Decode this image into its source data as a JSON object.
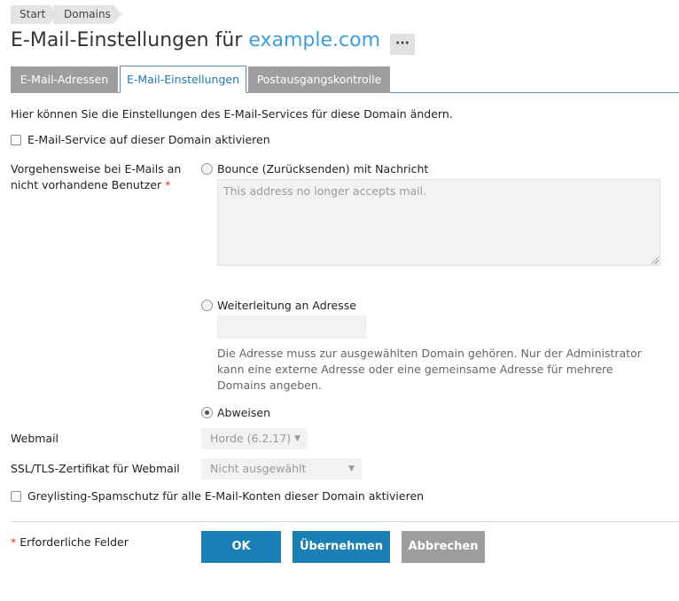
{
  "breadcrumb": [
    "Start",
    "Domains"
  ],
  "header": {
    "title_prefix": "E-Mail-Einstellungen für",
    "title_domain": "example.com",
    "more_label": "···"
  },
  "tabs": [
    {
      "label": "E-Mail-Adressen",
      "active": false
    },
    {
      "label": "E-Mail-Einstellungen",
      "active": true
    },
    {
      "label": "Postausgangskontrolle",
      "active": false
    }
  ],
  "intro": "Hier können Sie die Einstellungen des E-Mail-Services für diese Domain ändern.",
  "enable_mail_service": {
    "label": "E-Mail-Service auf dieser Domain aktivieren",
    "checked": false
  },
  "nonexistent_users": {
    "label_line1": "Vorgehensweise bei E-Mails an",
    "label_line2": "nicht vorhandene Benutzer",
    "required_mark": "*",
    "options": {
      "bounce": {
        "label": "Bounce (Zurücksenden) mit Nachricht",
        "checked": false,
        "message": "This address no longer accepts mail."
      },
      "forward": {
        "label": "Weiterleitung an Adresse",
        "checked": false,
        "value": "",
        "hint": "Die Adresse muss zur ausgewählten Domain gehören. Nur der Administrator kann eine externe Adresse oder eine gemeinsame Adresse für mehrere Domains angeben."
      },
      "reject": {
        "label": "Abweisen",
        "checked": true
      }
    }
  },
  "webmail": {
    "label": "Webmail",
    "selected": "Horde (6.2.17)"
  },
  "ssl_cert": {
    "label": "SSL/TLS-Zertifikat für Webmail",
    "selected": "Nicht ausgewählt"
  },
  "greylisting": {
    "label": "Greylisting-Spamschutz für alle E-Mail-Konten dieser Domain aktivieren",
    "checked": false
  },
  "footer": {
    "required_mark": "*",
    "required_text": "Erforderliche Felder",
    "ok_label": "OK",
    "apply_label": "Übernehmen",
    "cancel_label": "Abbrechen"
  }
}
